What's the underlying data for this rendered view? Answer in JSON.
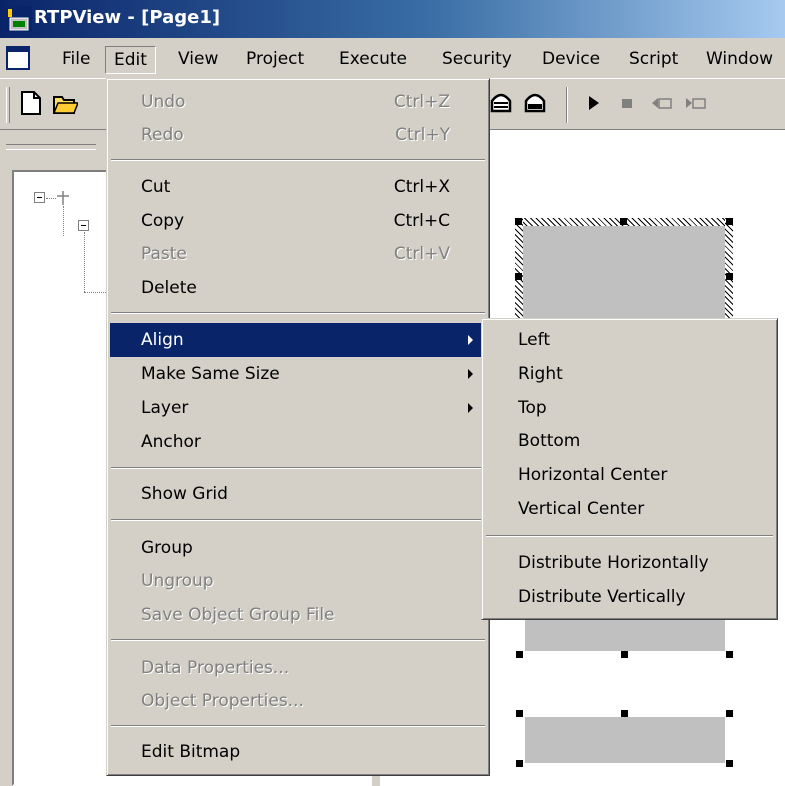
{
  "window": {
    "title": "RTPView - [Page1]",
    "app_icon_text": "HMI"
  },
  "menubar": [
    {
      "label": "File"
    },
    {
      "label": "Edit"
    },
    {
      "label": "View"
    },
    {
      "label": "Project"
    },
    {
      "label": "Execute"
    },
    {
      "label": "Security"
    },
    {
      "label": "Device"
    },
    {
      "label": "Script"
    },
    {
      "label": "Window"
    }
  ],
  "edit_menu": {
    "undo": {
      "label": "Undo",
      "shortcut": "Ctrl+Z"
    },
    "redo": {
      "label": "Redo",
      "shortcut": "Ctrl+Y"
    },
    "cut": {
      "label": "Cut",
      "shortcut": "Ctrl+X"
    },
    "copy": {
      "label": "Copy",
      "shortcut": "Ctrl+C"
    },
    "paste": {
      "label": "Paste",
      "shortcut": "Ctrl+V"
    },
    "delete": {
      "label": "Delete"
    },
    "align": {
      "label": "Align"
    },
    "make_same_size": {
      "label": "Make Same Size"
    },
    "layer": {
      "label": "Layer"
    },
    "anchor": {
      "label": "Anchor"
    },
    "show_grid": {
      "label": "Show Grid"
    },
    "group": {
      "label": "Group"
    },
    "ungroup": {
      "label": "Ungroup"
    },
    "save_object_group_file": {
      "label": "Save Object Group File"
    },
    "data_properties": {
      "label": "Data Properties..."
    },
    "object_properties": {
      "label": "Object Properties..."
    },
    "edit_bitmap": {
      "label": "Edit Bitmap"
    }
  },
  "align_submenu": {
    "left": "Left",
    "right": "Right",
    "top": "Top",
    "bottom": "Bottom",
    "horizontal_center": "Horizontal Center",
    "vertical_center": "Vertical Center",
    "distribute_horizontally": "Distribute Horizontally",
    "distribute_vertically": "Distribute Vertically"
  },
  "colors": {
    "highlight": "#0a246a",
    "face": "#d4d0c8",
    "disabled": "#808080",
    "shape": "#c0c0c0"
  }
}
